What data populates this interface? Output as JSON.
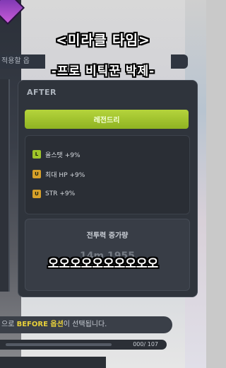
{
  "captions": {
    "top": "<미라클 타임>",
    "sub": "-프로 비틱꾼 박제-",
    "bottom": "오오오오오오오오오오"
  },
  "apply_label": "적용할 옵",
  "after_panel": {
    "title": "AFTER",
    "grade_label": "레전드리",
    "options": [
      {
        "grade": "L",
        "text": "올스탯 +9%"
      },
      {
        "grade": "U",
        "text": "최대 HP +9%"
      },
      {
        "grade": "U",
        "text": "STR +9%"
      }
    ],
    "power_label": "전투력 증가량",
    "power_value": "14m 1955"
  },
  "notice": {
    "prefix": "으로 ",
    "highlight": "BEFORE 옵션",
    "suffix": "이 선택됩니다."
  },
  "progress": {
    "text": "000/ 107",
    "current": 0,
    "total": 107
  },
  "colors": {
    "legendary": "#9fc62a",
    "unique": "#d6a02a",
    "highlight": "#e8d03a"
  }
}
